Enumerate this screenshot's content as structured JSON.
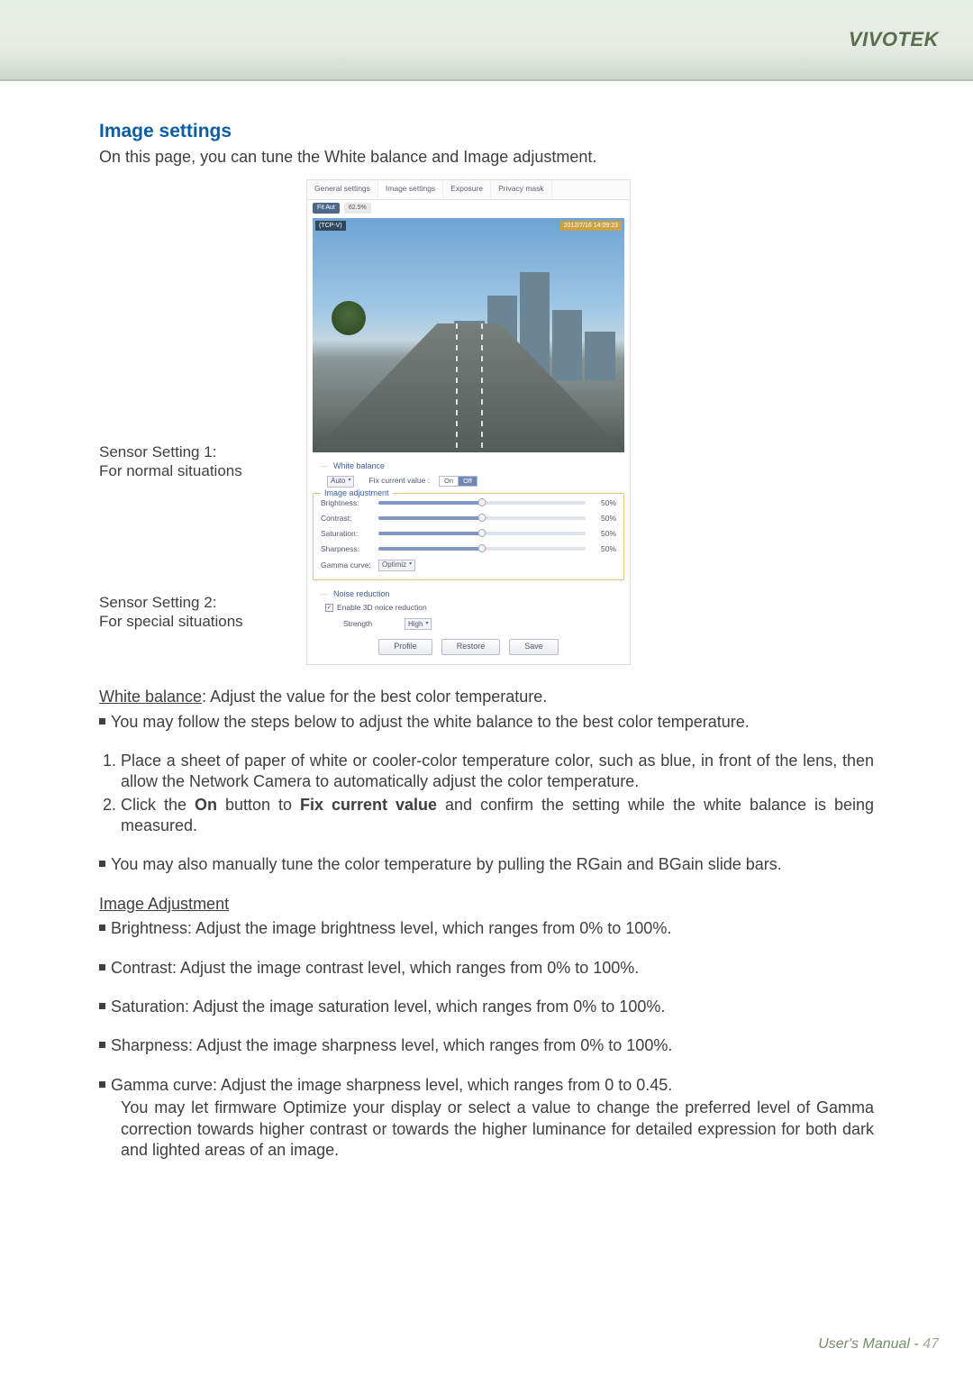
{
  "header": {
    "brand": "VIVOTEK"
  },
  "section": {
    "title": "Image settings",
    "intro": "On this page, you can tune the White balance and Image adjustment."
  },
  "callouts": {
    "one_line1": "Sensor Setting 1:",
    "one_line2": "For normal situations",
    "two_line1": "Sensor Setting 2:",
    "two_line2": "For special situations"
  },
  "panel": {
    "tabs": [
      "General settings",
      "Image settings",
      "Exposure",
      "Privacy mask"
    ],
    "active_tab": 1,
    "toolbar": {
      "fit": "Fit Aut",
      "pct": "62.5%"
    },
    "overlay": {
      "source": "(TCP-V)",
      "timestamp": "2012/7/16 14:09:23"
    },
    "white_balance": {
      "legend": "White balance",
      "mode_label": "Auto",
      "fix_label": "Fix current value :",
      "on": "On",
      "off": "Off"
    },
    "image_adjustment": {
      "legend": "Image adjustment",
      "brightness": {
        "label": "Brightness:",
        "value": "50%"
      },
      "contrast": {
        "label": "Contrast:",
        "value": "50%"
      },
      "saturation": {
        "label": "Saturation:",
        "value": "50%"
      },
      "sharpness": {
        "label": "Sharpness:",
        "value": "50%"
      },
      "gamma": {
        "label": "Gamma curve:",
        "select": "Optimiz"
      }
    },
    "noise_reduction": {
      "legend": "Noise reduction",
      "checkbox": "Enable 3D noice reduction",
      "strength_label": "Strength",
      "strength_value": "High"
    },
    "buttons": {
      "profile": "Profile",
      "restore": "Restore",
      "save": "Save"
    }
  },
  "body": {
    "wb_heading": "White balance",
    "wb_desc": ": Adjust the value for the best color temperature.",
    "wb_bullet1": "You may follow the steps below to adjust the white balance to the best color temperature.",
    "step1": "Place a sheet of paper of white or cooler-color temperature color, such as blue, in front of the lens, then allow the Network Camera to automatically adjust the color temperature.",
    "step2_a": "Click the ",
    "step2_b_bold": "On",
    "step2_c": " button to ",
    "step2_d_bold": "Fix current value",
    "step2_e": " and confirm the setting while the white balance is being measured.",
    "wb_bullet2": "You may also manually tune the color temperature by pulling the RGain and BGain slide bars.",
    "ia_heading": "Image Adjustment",
    "ia_brightness": "Brightness: Adjust the image brightness level, which ranges from 0% to 100%.",
    "ia_contrast": "Contrast: Adjust the image contrast level, which ranges from 0% to 100%.",
    "ia_saturation": "Saturation: Adjust the image saturation level, which ranges from 0% to 100%.",
    "ia_sharpness": "Sharpness: Adjust the image sharpness level, which ranges from 0% to 100%.",
    "ia_gamma_line1": "Gamma curve: Adjust the image sharpness level, which ranges from 0 to 0.45.",
    "ia_gamma_line2": "You may let firmware Optimize your display or select a value to change the preferred level of Gamma correction towards higher contrast or towards the higher luminance for detailed expression for both dark and lighted areas of an image."
  },
  "footer": {
    "text": "User's Manual - ",
    "page": "47"
  }
}
